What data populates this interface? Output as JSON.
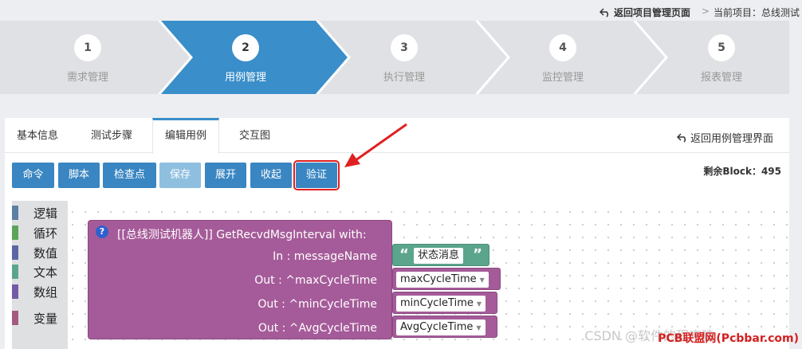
{
  "topbar": {
    "back_project": "返回项目管理页面",
    "separator": ">",
    "current_project": "当前项目：总线测试"
  },
  "steps": [
    {
      "num": "1",
      "label": "需求管理",
      "active": false
    },
    {
      "num": "2",
      "label": "用例管理",
      "active": true
    },
    {
      "num": "3",
      "label": "执行管理",
      "active": false
    },
    {
      "num": "4",
      "label": "监控管理",
      "active": false
    },
    {
      "num": "5",
      "label": "报表管理",
      "active": false
    }
  ],
  "tabs": [
    "基本信息",
    "测试步骤",
    "编辑用例",
    "交互图"
  ],
  "back_case": "返回用例管理界面",
  "toolbar": [
    "命令",
    "脚本",
    "检查点",
    "保存",
    "展开",
    "收起",
    "验证"
  ],
  "remaining_block": "剩余Block：495",
  "toolbox": [
    {
      "label": "逻辑",
      "color": "#5b80a5"
    },
    {
      "label": "循环",
      "color": "#5ba55b"
    },
    {
      "label": "数值",
      "color": "#5b67a5"
    },
    {
      "label": "文本",
      "color": "#5ba58c"
    },
    {
      "label": "数组",
      "color": "#745ba5"
    },
    {
      "label": "变量",
      "color": "#a55b80"
    }
  ],
  "block": {
    "help": "?",
    "header": "[[总线测试机器人]]   GetRecvdMsgInterval   with:",
    "params": [
      {
        "label": "In : messageName",
        "value": "状态消息"
      },
      {
        "label": "Out : ^maxCycleTime",
        "value": "maxCycleTime"
      },
      {
        "label": "Out : ^minCycleTime",
        "value": "minCycleTime"
      },
      {
        "label": "Out : ^AvgCycleTime",
        "value": "AvgCycleTime"
      }
    ]
  },
  "watermark": "PCB联盟网(Pcbbar.com)",
  "watermark_faded": "CSDN @软件的程序猿"
}
